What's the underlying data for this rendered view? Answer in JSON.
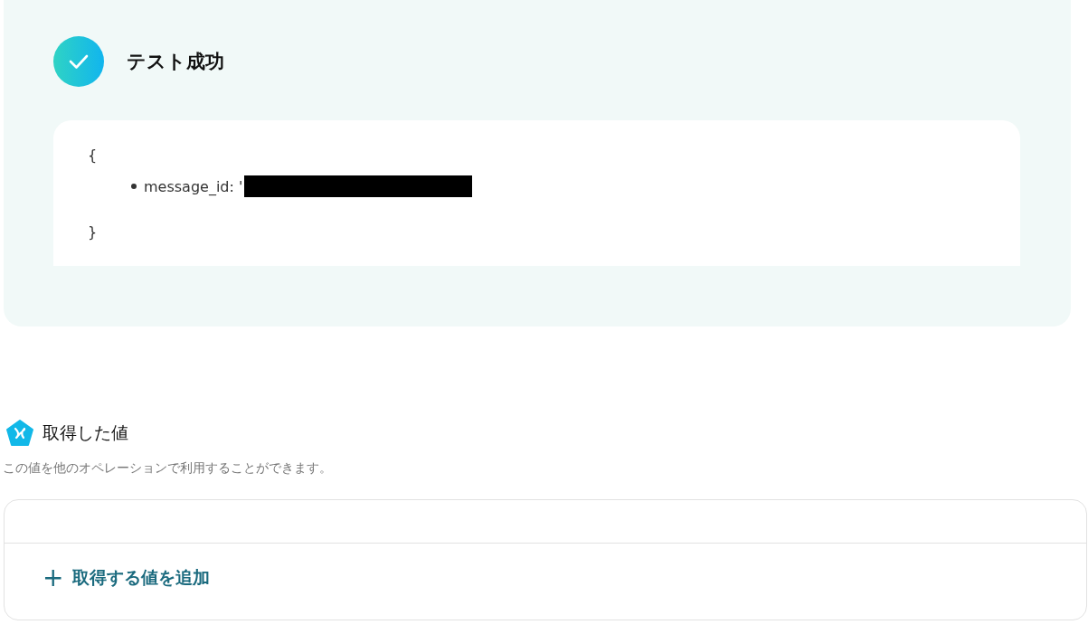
{
  "result": {
    "success": true,
    "title": "テスト成功",
    "open_brace": "{",
    "items": [
      {
        "key": "message_id: '",
        "redacted": true
      }
    ],
    "close_brace": "}"
  },
  "values": {
    "title": "取得した値",
    "description": "この値を他のオペレーションで利用することができます。",
    "add_button": {
      "icon": "+",
      "label": "取得する値を追加"
    }
  }
}
